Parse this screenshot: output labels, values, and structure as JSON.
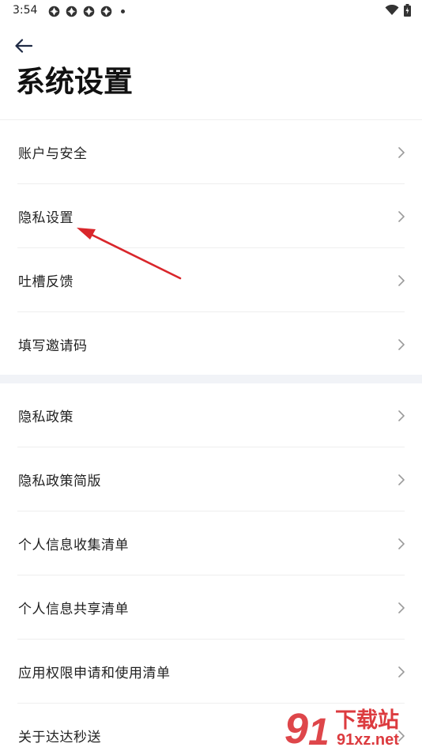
{
  "status_bar": {
    "time": "3:54",
    "notification_icons": [
      "app-notification-icon",
      "app-notification-icon",
      "app-notification-icon",
      "app-notification-icon"
    ],
    "right_icons": [
      "wifi-icon",
      "battery-icon"
    ]
  },
  "header": {
    "back_icon": "back-arrow-icon",
    "title": "系统设置"
  },
  "groups": [
    {
      "items": [
        {
          "label": "账户与安全"
        },
        {
          "label": "隐私设置"
        },
        {
          "label": "吐槽反馈"
        },
        {
          "label": "填写邀请码"
        }
      ]
    },
    {
      "items": [
        {
          "label": "隐私政策"
        },
        {
          "label": "隐私政策简版"
        },
        {
          "label": "个人信息收集清单"
        },
        {
          "label": "个人信息共享清单"
        },
        {
          "label": "应用权限申请和使用清单"
        },
        {
          "label": "关于达达秒送"
        }
      ]
    }
  ],
  "annotation": {
    "color": "#d9262b"
  },
  "watermark": {
    "text_top": "下载站",
    "text_bottom": "91xz.net",
    "color": "#d9262b"
  },
  "colors": {
    "divider": "#eeeeee",
    "section_bg": "#f1f3f7",
    "chevron": "#9a9a9a"
  }
}
